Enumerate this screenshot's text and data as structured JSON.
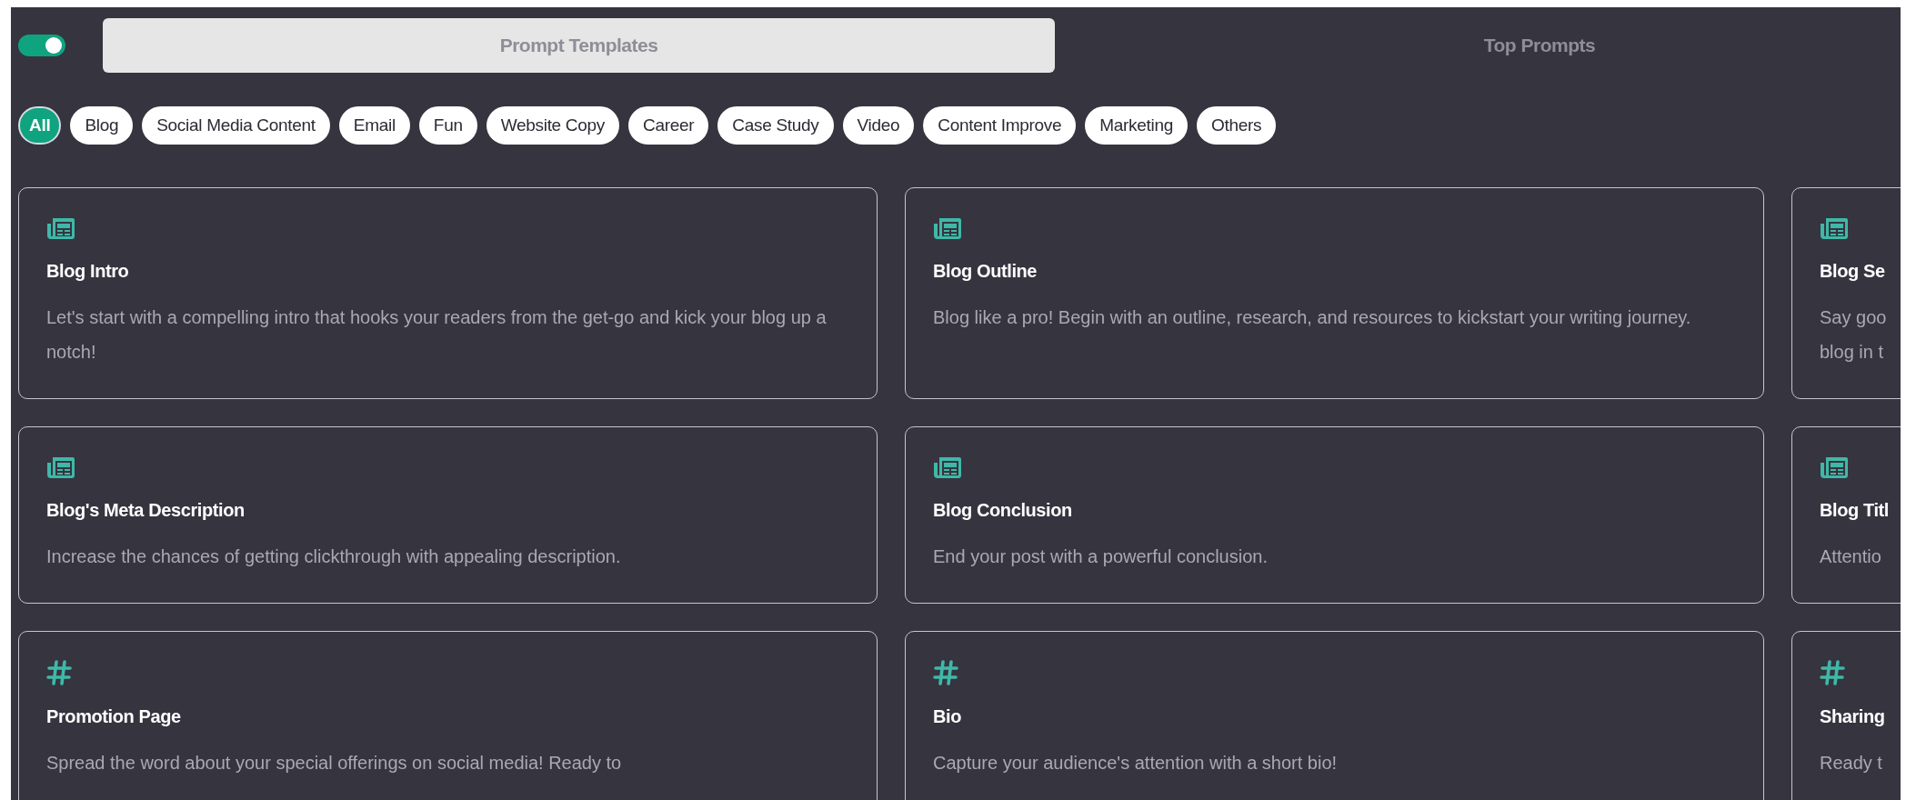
{
  "toggle": {
    "on": true
  },
  "tabs": [
    {
      "label": "Prompt Templates",
      "selected": true
    },
    {
      "label": "Top Prompts",
      "selected": false
    }
  ],
  "categories": [
    {
      "label": "All",
      "selected": true
    },
    {
      "label": "Blog",
      "selected": false
    },
    {
      "label": "Social Media Content",
      "selected": false
    },
    {
      "label": "Email",
      "selected": false
    },
    {
      "label": "Fun",
      "selected": false
    },
    {
      "label": "Website Copy",
      "selected": false
    },
    {
      "label": "Career",
      "selected": false
    },
    {
      "label": "Case Study",
      "selected": false
    },
    {
      "label": "Video",
      "selected": false
    },
    {
      "label": "Content Improve",
      "selected": false
    },
    {
      "label": "Marketing",
      "selected": false
    },
    {
      "label": "Others",
      "selected": false
    }
  ],
  "cards": [
    {
      "kind": "newspaper",
      "title": "Blog Intro",
      "description": "Let's start with a compelling intro that hooks your readers from the get-go and kick your blog up a notch!"
    },
    {
      "kind": "newspaper",
      "title": "Blog Outline",
      "description": "Blog like a pro! Begin with an outline, research, and resources to kickstart your writing journey."
    },
    {
      "kind": "newspaper",
      "title": "Blog Se",
      "description": "Say goo\nblog in t"
    },
    {
      "kind": "newspaper",
      "title": "Blog's Meta Description",
      "description": "Increase the chances of getting clickthrough with appealing description."
    },
    {
      "kind": "newspaper",
      "title": "Blog Conclusion",
      "description": "End your post with a powerful conclusion."
    },
    {
      "kind": "newspaper",
      "title": "Blog Titl",
      "description": "Attentio"
    },
    {
      "kind": "hash",
      "title": "Promotion Page",
      "description": "Spread the word about your special offerings on social media! Ready to"
    },
    {
      "kind": "hash",
      "title": "Bio",
      "description": "Capture your audience's attention with a short bio!"
    },
    {
      "kind": "hash",
      "title": "Sharing",
      "description": "Ready t"
    }
  ]
}
